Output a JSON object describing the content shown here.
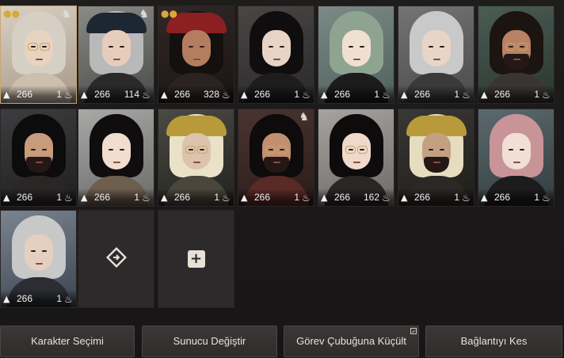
{
  "characters": [
    {
      "level": "266",
      "energy": "1",
      "selected": true,
      "badge": true,
      "deco": true
    },
    {
      "level": "266",
      "energy": "114",
      "selected": false,
      "badge": false,
      "deco": true
    },
    {
      "level": "266",
      "energy": "328",
      "selected": false,
      "badge": true,
      "deco": false
    },
    {
      "level": "266",
      "energy": "1",
      "selected": false,
      "badge": false,
      "deco": false
    },
    {
      "level": "266",
      "energy": "1",
      "selected": false,
      "badge": false,
      "deco": false
    },
    {
      "level": "266",
      "energy": "1",
      "selected": false,
      "badge": false,
      "deco": false
    },
    {
      "level": "266",
      "energy": "1",
      "selected": false,
      "badge": false,
      "deco": false
    },
    {
      "level": "266",
      "energy": "1",
      "selected": false,
      "badge": false,
      "deco": false
    },
    {
      "level": "266",
      "energy": "1",
      "selected": false,
      "badge": false,
      "deco": false
    },
    {
      "level": "266",
      "energy": "1",
      "selected": false,
      "badge": false,
      "deco": false
    },
    {
      "level": "266",
      "energy": "1",
      "selected": false,
      "badge": false,
      "deco": true
    },
    {
      "level": "266",
      "energy": "162",
      "selected": false,
      "badge": false,
      "deco": false
    },
    {
      "level": "266",
      "energy": "1",
      "selected": false,
      "badge": false,
      "deco": false
    },
    {
      "level": "266",
      "energy": "1",
      "selected": false,
      "badge": false,
      "deco": false
    },
    {
      "level": "266",
      "energy": "1",
      "selected": false,
      "badge": false,
      "deco": false
    }
  ],
  "icons": {
    "level_icon": "boot-icon",
    "energy_icon": "flame-icon",
    "badge_icon": "people-icon",
    "deco_icon": "horse-head-icon",
    "transfer_icon": "diamond-arrow-icon",
    "add_icon": "plus-icon"
  },
  "buttons": {
    "character_select": "Karakter Seçimi",
    "change_server": "Sunucu Değiştir",
    "minimize_taskbar": "Görev Çubuğuna Küçült",
    "disconnect": "Bağlantıyı Kes"
  },
  "colors": {
    "background": "#1b1919",
    "selected_border": "#c9a870",
    "button_text": "#e6e2dc",
    "badge_gold": "#d9a83a"
  }
}
